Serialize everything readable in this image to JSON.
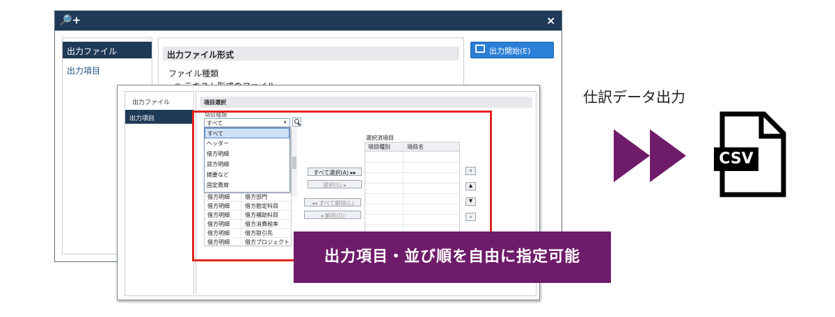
{
  "back_window": {
    "title_icon": "🔎+",
    "close": "×",
    "sidebar": {
      "selected": "出力ファイル",
      "item": "出力項目"
    },
    "section_title": "出力ファイル形式",
    "file_type_label": "ファイル種類",
    "radio_label": "テキスト形式のファイル",
    "start_button": "出力開始(E)"
  },
  "front_window": {
    "sidebar": {
      "item": "出力ファイル",
      "selected": "出力項目"
    },
    "section_title": "項目選択",
    "field_label": "項目種類",
    "combo_value": "すべて",
    "dropdown_options": [
      "すべて",
      "ヘッダー",
      "借方明細",
      "貸方明細",
      "摘要など",
      "固定費扉"
    ],
    "list_rows": [
      [
        "借方明細",
        "借方部門"
      ],
      [
        "借方明細",
        "借方勘定科目"
      ],
      [
        "借方明細",
        "借方補助科目"
      ],
      [
        "借方明細",
        "借方消費税率"
      ],
      [
        "借方明細",
        "借方取引先"
      ],
      [
        "借方明細",
        "借方プロジェクト"
      ]
    ],
    "buttons": {
      "select_all": "すべて選択(A) ▸▸",
      "select": "選択(S) ▸",
      "clear_all": "◂◂ すべて解除(L)",
      "clear": "◂ 解除(D)"
    },
    "selected_title": "選択済項目",
    "selected_columns": [
      "項目種別",
      "項目名"
    ],
    "sort_buttons": [
      "⌅",
      "▲",
      "▼",
      "⌄"
    ]
  },
  "callout_text": "出力項目・並び順を自由に指定可能",
  "export_label": "仕訳データ出力",
  "csv_label": "CSV",
  "colors": {
    "accent": "#6e1b6a",
    "highlight": "#e0241f",
    "titlebar": "#1f3a57",
    "button": "#2b7fd6"
  }
}
